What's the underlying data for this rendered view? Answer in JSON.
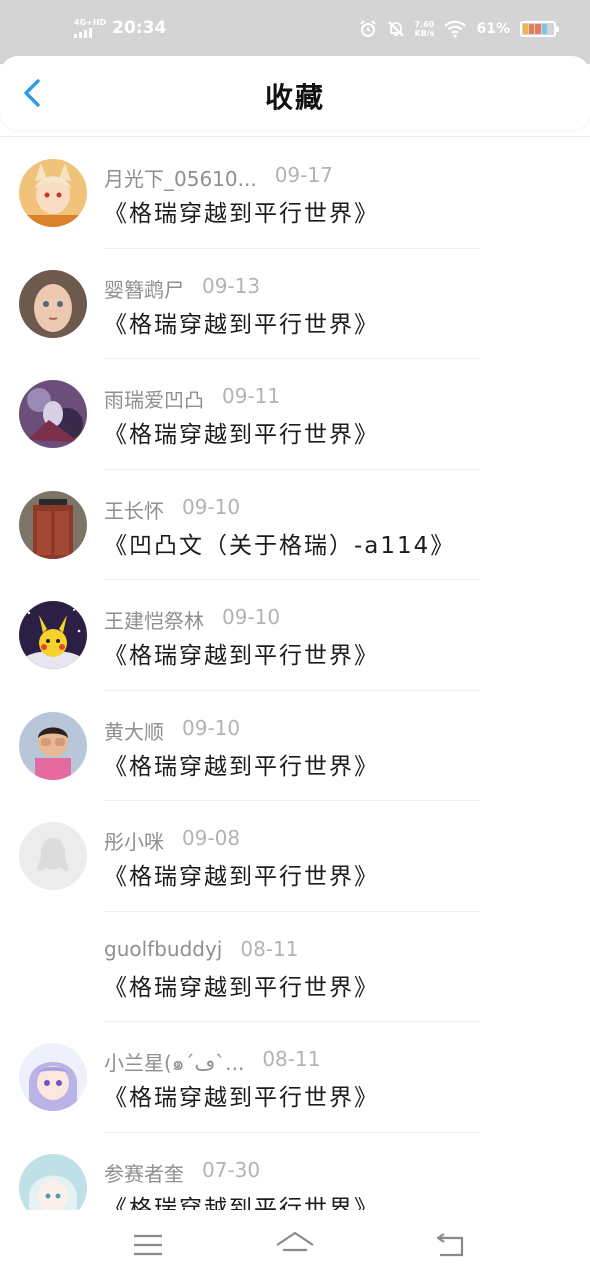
{
  "status_bar": {
    "network": "4G+HD",
    "time": "20:34",
    "speed_value": "7.60",
    "speed_unit": "KB/s",
    "battery": "61%"
  },
  "header": {
    "title": "收藏",
    "back_icon": "chevron-left-icon"
  },
  "favorites": [
    {
      "name": "月光下_05610...",
      "date": "09-17",
      "title": "《格瑞穿越到平行世界》",
      "avatar": "anime-girl-fox-ears",
      "color": "#e8a34a"
    },
    {
      "name": "婴簪鹉尸",
      "date": "09-13",
      "title": "《格瑞穿越到平行世界》",
      "avatar": "girl-portrait",
      "color": "#c9a089"
    },
    {
      "name": "雨瑞爱凹凸",
      "date": "09-11",
      "title": "《格瑞穿越到平行世界》",
      "avatar": "anime-dark-art",
      "color": "#6b4e7a"
    },
    {
      "name": "王长怀",
      "date": "09-10",
      "title": "《凹凸文（关于格瑞）-a114》",
      "avatar": "red-door",
      "color": "#8c3a2a"
    },
    {
      "name": "王建恺祭林",
      "date": "09-10",
      "title": "《格瑞穿越到平行世界》",
      "avatar": "pikachu",
      "color": "#2b1f45"
    },
    {
      "name": "黄大顺",
      "date": "09-10",
      "title": "《格瑞穿越到平行世界》",
      "avatar": "crying-child",
      "color": "#b7c6d8"
    },
    {
      "name": "彤小咪",
      "date": "09-08",
      "title": "《格瑞穿越到平行世界》",
      "avatar": "default-penguin",
      "color": "#ececec"
    },
    {
      "name": "guolfbuddyj",
      "date": "08-11",
      "title": "《格瑞穿越到平行世界》",
      "avatar": "none",
      "color": "#ffffff"
    },
    {
      "name": "小兰星(๑´ڡ`...",
      "date": "08-11",
      "title": "《格瑞穿越到平行世界》",
      "avatar": "anime-purple-hair",
      "color": "#b9b3e6"
    },
    {
      "name": "参赛者奎",
      "date": "07-30",
      "title": "《格瑞穿越到平行世界》",
      "avatar": "anime-light-blue",
      "color": "#bfe0e6"
    }
  ],
  "nav_bar": {
    "menu_icon": "menu-icon",
    "home_icon": "home-icon",
    "back_icon": "back-arrow-icon"
  }
}
